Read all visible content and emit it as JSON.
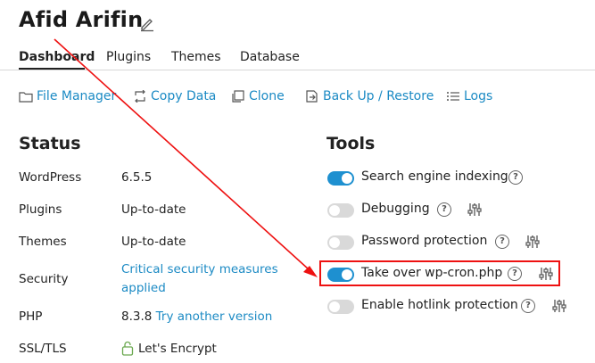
{
  "header": {
    "title": "Afid Arifin"
  },
  "tabs": [
    {
      "label": "Dashboard",
      "active": true
    },
    {
      "label": "Plugins"
    },
    {
      "label": "Themes"
    },
    {
      "label": "Database"
    }
  ],
  "toolbar": {
    "file_manager": "File Manager",
    "copy_data": "Copy Data",
    "clone": "Clone",
    "backup_restore": "Back Up / Restore",
    "logs": "Logs"
  },
  "status": {
    "title": "Status",
    "rows": [
      {
        "label": "WordPress",
        "value": "6.5.5"
      },
      {
        "label": "Plugins",
        "value": "Up-to-date"
      },
      {
        "label": "Themes",
        "value": "Up-to-date"
      },
      {
        "label": "Security",
        "value_line1": "Critical security measures",
        "value_line2": "applied"
      },
      {
        "label": "PHP",
        "value": "8.3.8",
        "link": "Try another version"
      },
      {
        "label": "SSL/TLS",
        "value": "Let's Encrypt"
      }
    ]
  },
  "tools": {
    "title": "Tools",
    "items": [
      {
        "label": "Search engine indexing",
        "enabled": true
      },
      {
        "label": "Debugging",
        "enabled": false
      },
      {
        "label": "Password protection",
        "enabled": false
      },
      {
        "label": "Take over wp-cron.php",
        "enabled": true
      },
      {
        "label": "Enable hotlink protection",
        "enabled": false
      }
    ]
  },
  "colors": {
    "accent": "#1e90d0",
    "link": "#1b8ac4",
    "annotation": "#e11111"
  },
  "help_glyph": "?"
}
